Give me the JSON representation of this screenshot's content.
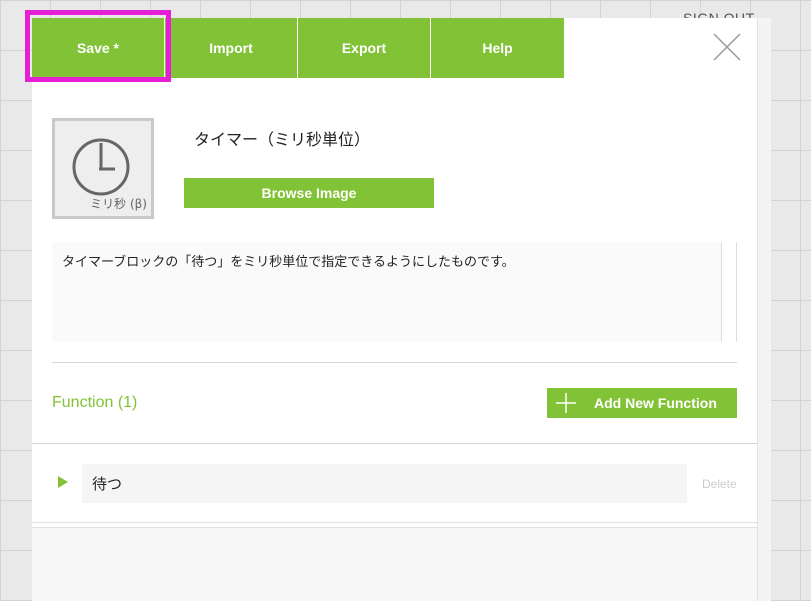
{
  "backdrop": {
    "signout_label": "SIGN OUT"
  },
  "tabs": [
    {
      "label": "Save *"
    },
    {
      "label": "Import"
    },
    {
      "label": "Export"
    },
    {
      "label": "Help"
    }
  ],
  "block": {
    "icon_name": "clock-icon",
    "icon_caption": "ミリ秒 (β)",
    "name_value": "タイマー（ミリ秒単位）",
    "browse_label": "Browse Image",
    "description": "タイマーブロックの「待つ」をミリ秒単位で指定できるようにしたものです。"
  },
  "functions": {
    "title": "Function (1)",
    "add_label": "Add New Function",
    "items": [
      {
        "name": "待つ",
        "delete_label": "Delete"
      }
    ]
  },
  "colors": {
    "accent": "#82c236",
    "highlight": "#e61fd7"
  }
}
